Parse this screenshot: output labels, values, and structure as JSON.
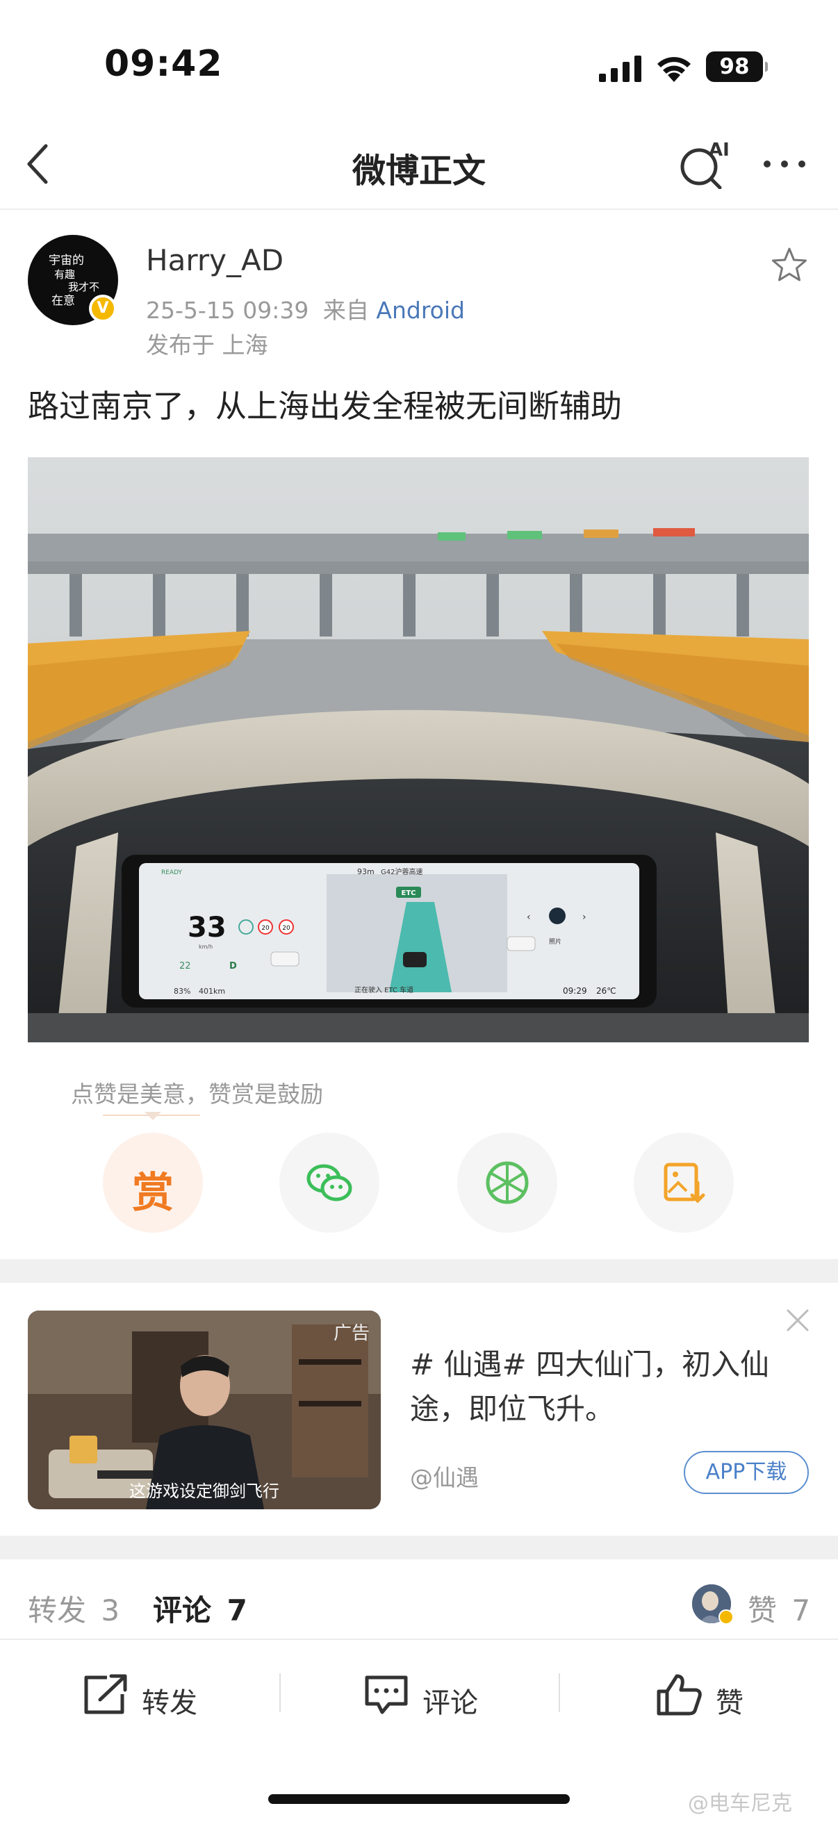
{
  "status_bar": {
    "time": "09:42",
    "battery": "98"
  },
  "nav": {
    "title": "微博正文",
    "ai_label": "AI"
  },
  "post": {
    "author": "Harry_AD",
    "verified": "V",
    "time": "25-5-15 09:39",
    "from_prefix": "来自",
    "source": "Android",
    "location": "发布于 上海",
    "text": "路过南京了，从上海出发全程被无间断辅助",
    "avatar_lines": [
      "宇宙的",
      "有趣",
      "我才不",
      "在意"
    ]
  },
  "photo_dash": {
    "ready": "READY",
    "speed": "33",
    "speed_unit": "km/h",
    "limit1": "20",
    "limit2": "20",
    "range": "22",
    "gear": "D",
    "battery": "83%",
    "odometer": "401km",
    "distance": "93m",
    "road": "G42沪蓉高速",
    "etc": "ETC",
    "etc_msg": "正在驶入 ETC 车道",
    "clock": "09:29",
    "temp": "26℃",
    "media": "照片"
  },
  "reward": {
    "tip": "点赞是美意，赞赏是鼓励",
    "reward_label": "赏"
  },
  "ad": {
    "tag": "广告",
    "subtitle": "这游戏设定御剑飞行",
    "text": "# 仙遇# 四大仙门，初入仙途，即位飞升。",
    "account": "@仙遇",
    "button": "APP下载"
  },
  "counts": {
    "repost_label": "转发",
    "repost": "3",
    "comment_label": "评论",
    "comment": "7",
    "like_label": "赞",
    "like": "7"
  },
  "toolbar": {
    "repost": "转发",
    "comment": "评论",
    "like": "赞"
  },
  "watermark": "@电车尼克",
  "colors": {
    "accent_blue": "#4a78b8",
    "reward_orange": "#f07a21",
    "wechat_green": "#3cbe5a",
    "verify_gold": "#f5b800"
  }
}
